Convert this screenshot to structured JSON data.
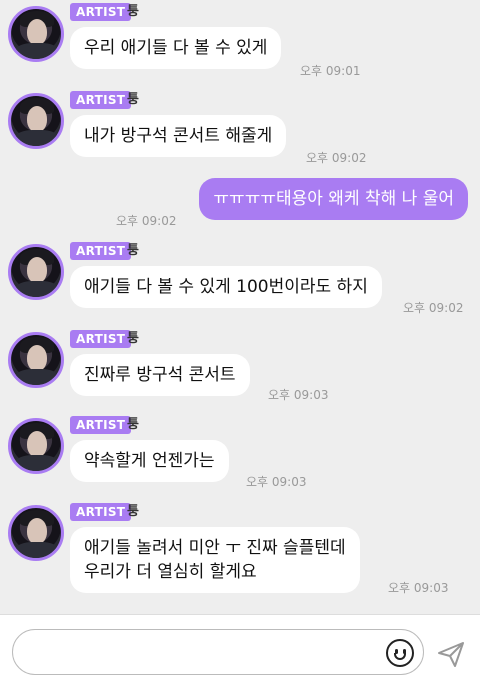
{
  "colors": {
    "accent": "#a97cf2",
    "background": "#eeeeee",
    "bubble_in": "#ffffff"
  },
  "messages": [
    {
      "badge": "ARTIST",
      "sender": "퉁",
      "text": "우리 애기들 다 볼 수 있게",
      "time": "오후 09:01"
    },
    {
      "badge": "ARTIST",
      "sender": "퉁",
      "text": "내가 방구석 콘서트 해줄게",
      "time": "오후 09:02"
    },
    {
      "text": "ㅠㅠㅠㅠ태용아 왜케 착해 나 울어",
      "time": "오후 09:02",
      "outgoing": true
    },
    {
      "badge": "ARTIST",
      "sender": "퉁",
      "text": "애기들 다 볼 수 있게 100번이라도 하지",
      "time": "오후 09:02"
    },
    {
      "badge": "ARTIST",
      "sender": "퉁",
      "text": "진짜루 방구석 콘서트",
      "time": "오후 09:03"
    },
    {
      "badge": "ARTIST",
      "sender": "퉁",
      "text": "약속할게 언젠가는",
      "time": "오후 09:03"
    },
    {
      "badge": "ARTIST",
      "sender": "퉁",
      "text": "애기들 놀려서 미안 ㅜ 진짜 슬플텐데\n우리가 더 열심히 할게요",
      "time": "오후 09:03"
    }
  ],
  "input": {
    "value": "",
    "emoji_icon": "smiley-icon",
    "send_icon": "paper-plane-icon"
  }
}
